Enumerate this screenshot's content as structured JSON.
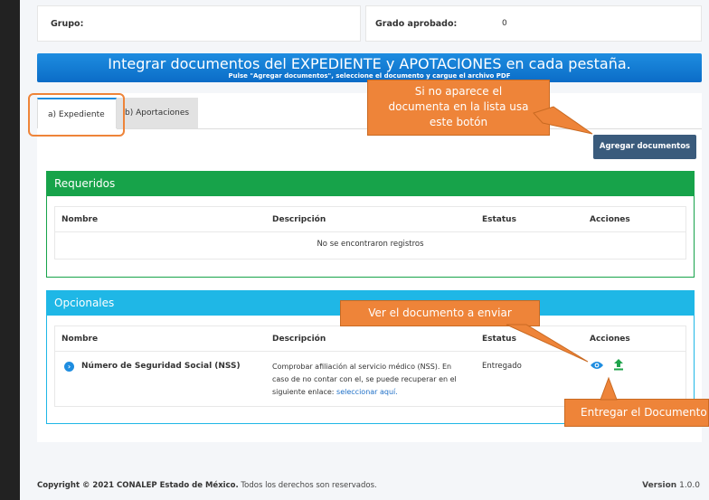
{
  "top": {
    "grupo_label": "Grupo:",
    "grado_label": "Grado aprobado:",
    "grado_value": "0"
  },
  "banner": {
    "title": "Integrar documentos del EXPEDIENTE y APOTACIONES en cada pestaña.",
    "subtitle": "Pulse \"Agregar documentos\", seleccione el documento y cargue el archivo PDF"
  },
  "tabs": [
    {
      "label": "a) Expediente"
    },
    {
      "label": "b) Aportaciones"
    }
  ],
  "add_button": "Agregar documentos",
  "requeridos": {
    "title": "Requeridos",
    "headers": [
      "Nombre",
      "Descripción",
      "Estatus",
      "Acciones"
    ],
    "empty": "No se encontraron registros"
  },
  "opcionales": {
    "title": "Opcionales",
    "headers": [
      "Nombre",
      "Descripción",
      "Estatus",
      "Acciones"
    ],
    "row": {
      "name": "Número de Seguridad Social (NSS)",
      "desc_1": "Comprobar afiliación al servicio médico (NSS). En",
      "desc_2": "caso de no contar con el, se puede recuperar en el",
      "desc_3": "siguiente enlace:",
      "link": "seleccionar aquí.",
      "status": "Entregado"
    }
  },
  "callouts": {
    "no_aparece": [
      "Si no aparece el",
      "documenta en la lista usa",
      "este botón"
    ],
    "ver": "Ver el documento a enviar",
    "entregar": "Entregar el Documento"
  },
  "footer": {
    "copyright": "Copyright © 2021 CONALEP Estado de México.",
    "rights": "Todos los derechos son reservados.",
    "version_label": "Version",
    "version_value": "1.0.0"
  },
  "colors": {
    "banner": "#0b6cc7",
    "requeridos": "#17a34a",
    "opcionales": "#1fb7e6",
    "callout": "#ee8439",
    "button": "#3a5b7c"
  },
  "icons": [
    "info-circle-icon",
    "eye-icon",
    "upload-icon"
  ]
}
